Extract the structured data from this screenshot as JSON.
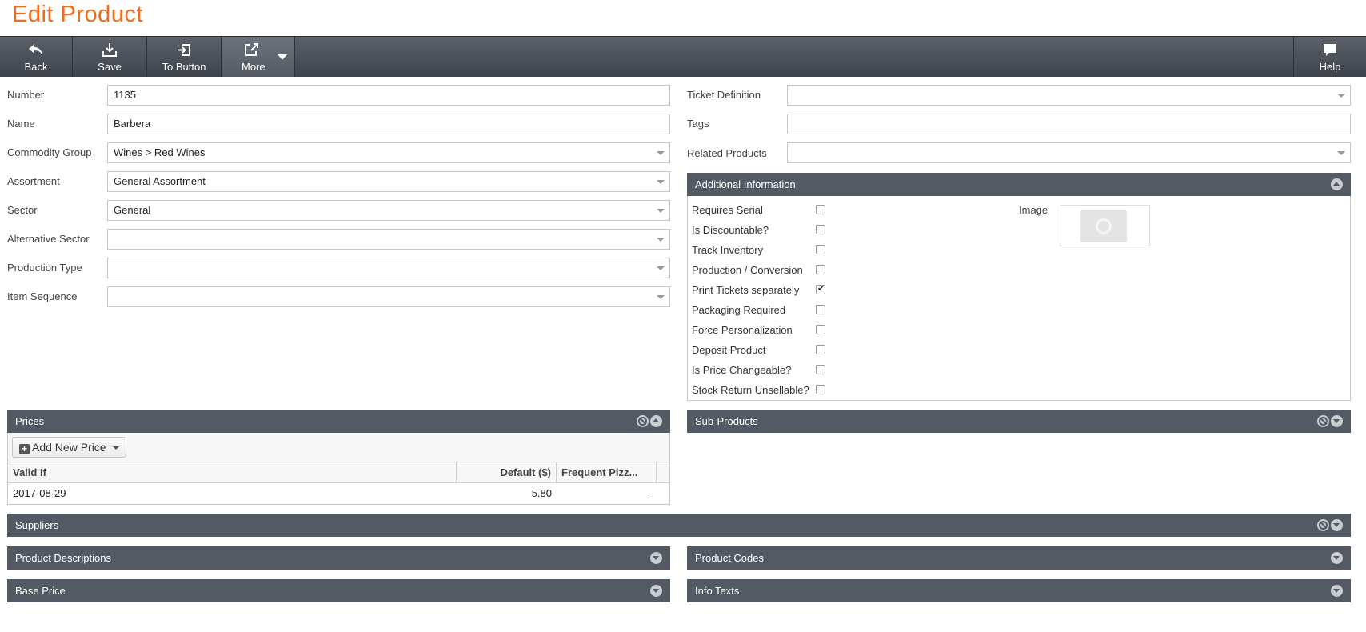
{
  "page": {
    "title": "Edit Product"
  },
  "toolbar": {
    "back": "Back",
    "save": "Save",
    "to_button": "To Button",
    "more": "More",
    "help": "Help"
  },
  "form_left": {
    "number": {
      "label": "Number",
      "value": "1135"
    },
    "name": {
      "label": "Name",
      "value": "Barbera"
    },
    "commodity_group": {
      "label": "Commodity Group",
      "value": "Wines > Red Wines"
    },
    "assortment": {
      "label": "Assortment",
      "value": "General Assortment"
    },
    "sector": {
      "label": "Sector",
      "value": "General"
    },
    "alternative_sector": {
      "label": "Alternative Sector",
      "value": ""
    },
    "production_type": {
      "label": "Production Type",
      "value": ""
    },
    "item_sequence": {
      "label": "Item Sequence",
      "value": ""
    }
  },
  "form_right": {
    "ticket_definition": {
      "label": "Ticket Definition",
      "value": ""
    },
    "tags": {
      "label": "Tags",
      "value": ""
    },
    "related_products": {
      "label": "Related Products",
      "value": ""
    }
  },
  "additional_info": {
    "title": "Additional Information",
    "image_label": "Image",
    "checkboxes": [
      {
        "label": "Requires Serial",
        "checked": false
      },
      {
        "label": "Is Discountable?",
        "checked": false
      },
      {
        "label": "Track Inventory",
        "checked": false
      },
      {
        "label": "Production / Conversion",
        "checked": false
      },
      {
        "label": "Print Tickets separately",
        "checked": true
      },
      {
        "label": "Packaging Required",
        "checked": false
      },
      {
        "label": "Force Personalization",
        "checked": false
      },
      {
        "label": "Deposit Product",
        "checked": false
      },
      {
        "label": "Is Price Changeable?",
        "checked": false
      },
      {
        "label": "Stock Return Unsellable?",
        "checked": false
      }
    ]
  },
  "prices": {
    "title": "Prices",
    "add_button": "Add New Price",
    "columns": [
      "Valid If",
      "Default ($)",
      "Frequent Pizz..."
    ],
    "rows": [
      {
        "valid_if": "2017-08-29",
        "default": "5.80",
        "frequent": "-"
      }
    ]
  },
  "panels": {
    "sub_products": "Sub-Products",
    "suppliers": "Suppliers",
    "product_descriptions": "Product Descriptions",
    "product_codes": "Product Codes",
    "base_price": "Base Price",
    "info_texts": "Info Texts"
  },
  "colors": {
    "title_orange": "#f26b1d",
    "toolbar_dark": "#3f444c",
    "panel_header": "#545a63"
  }
}
